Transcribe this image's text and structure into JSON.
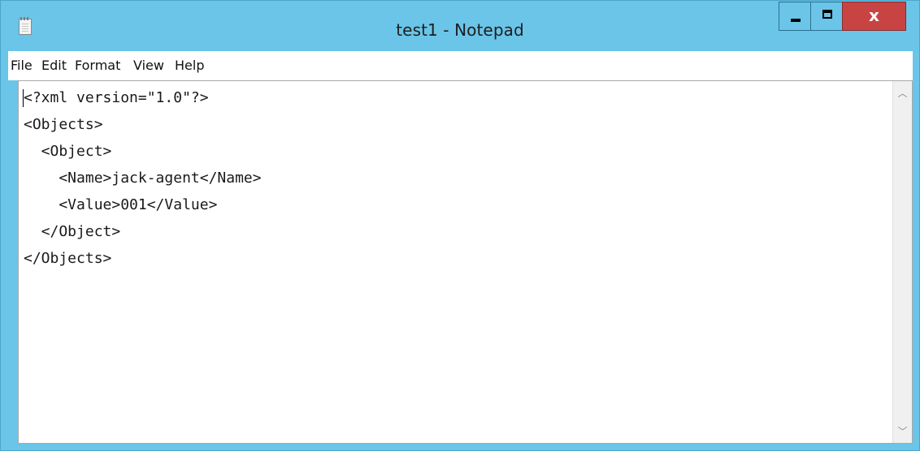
{
  "window": {
    "title": "test1 - Notepad",
    "close_label": "x"
  },
  "menu": {
    "items": [
      "File",
      "Edit",
      "Format",
      "View",
      "Help"
    ]
  },
  "editor": {
    "content": "<?xml version=\"1.0\"?>\n<Objects>\n  <Object>\n    <Name>jack-agent</Name>\n    <Value>001</Value>\n  </Object>\n</Objects>"
  },
  "scrollbar": {
    "up_glyph": "︿",
    "down_glyph": "﹀"
  },
  "colors": {
    "titlebar": "#6ac5e8",
    "close_button": "#c74443"
  }
}
